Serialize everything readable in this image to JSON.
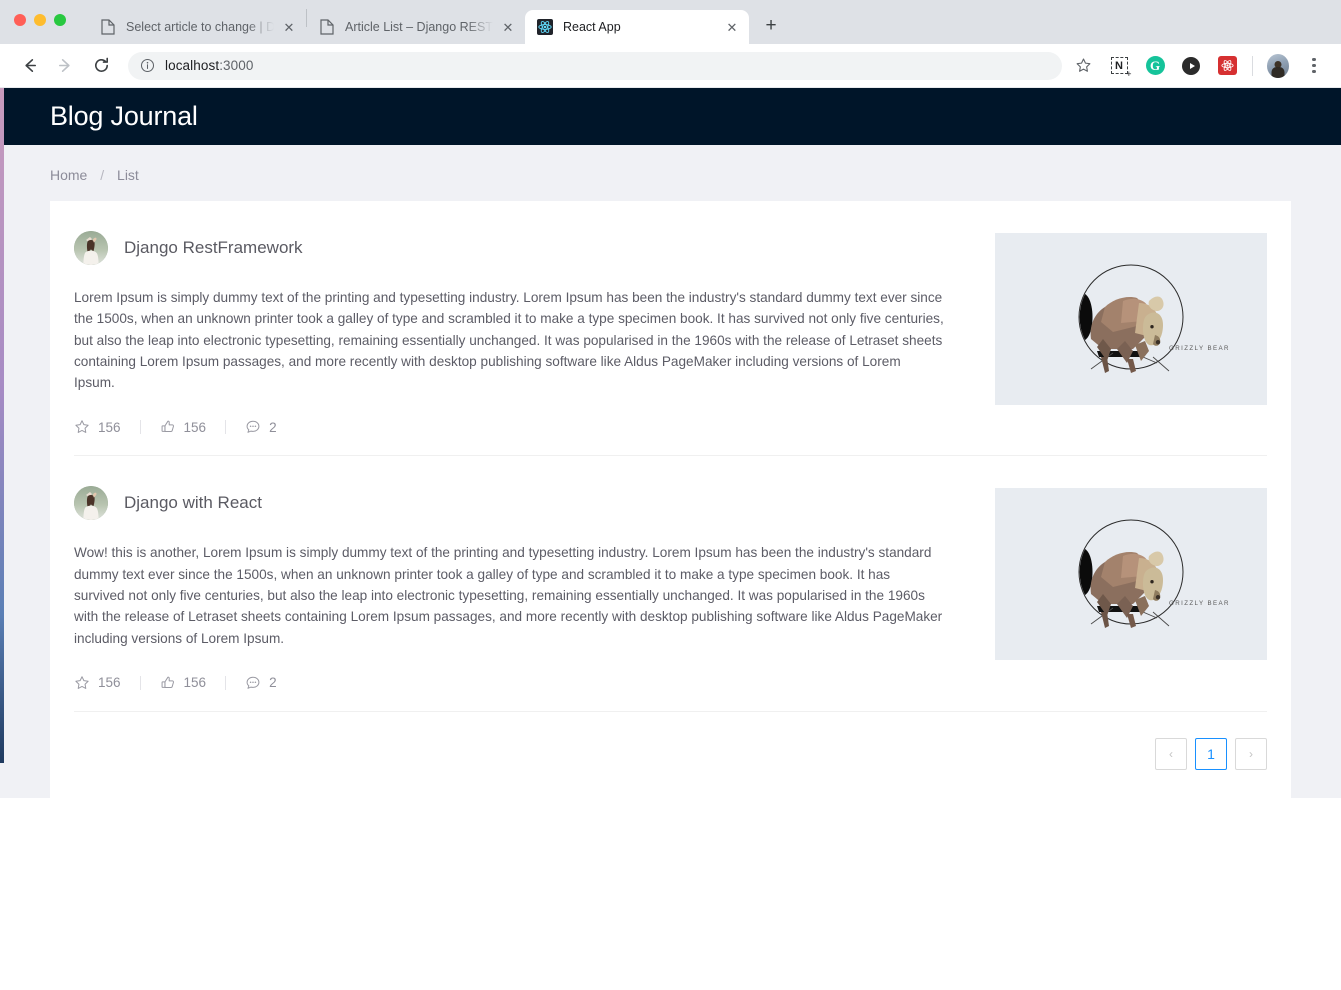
{
  "browser": {
    "tabs": [
      {
        "title": "Select article to change | Djang",
        "favicon": "page-icon",
        "active": false
      },
      {
        "title": "Article List – Django REST fram",
        "favicon": "page-icon",
        "active": false
      },
      {
        "title": "React App",
        "favicon": "react-icon",
        "active": true
      }
    ],
    "new_tab_label": "+",
    "close_label": "✕",
    "nav": {
      "back": "←",
      "forward": "→",
      "reload": "⟳"
    },
    "url": {
      "host": "localhost",
      "port": ":3000"
    },
    "extensions": [
      {
        "name": "bookmark-star-icon",
        "label": "☆"
      },
      {
        "name": "notion-clipper-icon",
        "label": "N"
      },
      {
        "name": "grammarly-icon",
        "label": "G"
      },
      {
        "name": "play-extension-icon",
        "label": "▶"
      },
      {
        "name": "react-devtools-icon",
        "label": ""
      },
      {
        "name": "profile-avatar",
        "label": ""
      },
      {
        "name": "chrome-menu-icon",
        "label": "⋮"
      }
    ]
  },
  "app": {
    "title": "Blog Journal",
    "header_bg": "#001529",
    "accent": "#1890ff",
    "breadcrumb": {
      "home": "Home",
      "separator": "/",
      "current": "List"
    },
    "articles": [
      {
        "author_avatar": "user-avatar",
        "title": "Django RestFramework",
        "body": "Lorem Ipsum is simply dummy text of the printing and typesetting industry. Lorem Ipsum has been the industry's standard dummy text ever since the 1500s, when an unknown printer took a galley of type and scrambled it to make a type specimen book. It has survived not only five centuries, but also the leap into electronic typesetting, remaining essentially unchanged. It was popularised in the 1960s with the release of Letraset sheets containing Lorem Ipsum passages, and more recently with desktop publishing software like Aldus PageMaker including versions of Lorem Ipsum.",
        "actions": {
          "star_count": "156",
          "like_count": "156",
          "comment_count": "2"
        },
        "thumbnail_caption": "GRIZZLY BEAR"
      },
      {
        "author_avatar": "user-avatar",
        "title": "Django with React",
        "body": "Wow! this is another, Lorem Ipsum is simply dummy text of the printing and typesetting industry. Lorem Ipsum has been the industry's standard dummy text ever since the 1500s, when an unknown printer took a galley of type and scrambled it to make a type specimen book. It has survived not only five centuries, but also the leap into electronic typesetting, remaining essentially unchanged. It was popularised in the 1960s with the release of Letraset sheets containing Lorem Ipsum passages, and more recently with desktop publishing software like Aldus PageMaker including versions of Lorem Ipsum.",
        "actions": {
          "star_count": "156",
          "like_count": "156",
          "comment_count": "2"
        },
        "thumbnail_caption": "GRIZZLY BEAR"
      }
    ],
    "pagination": {
      "prev": "‹",
      "current_page": "1",
      "next": "›"
    }
  }
}
